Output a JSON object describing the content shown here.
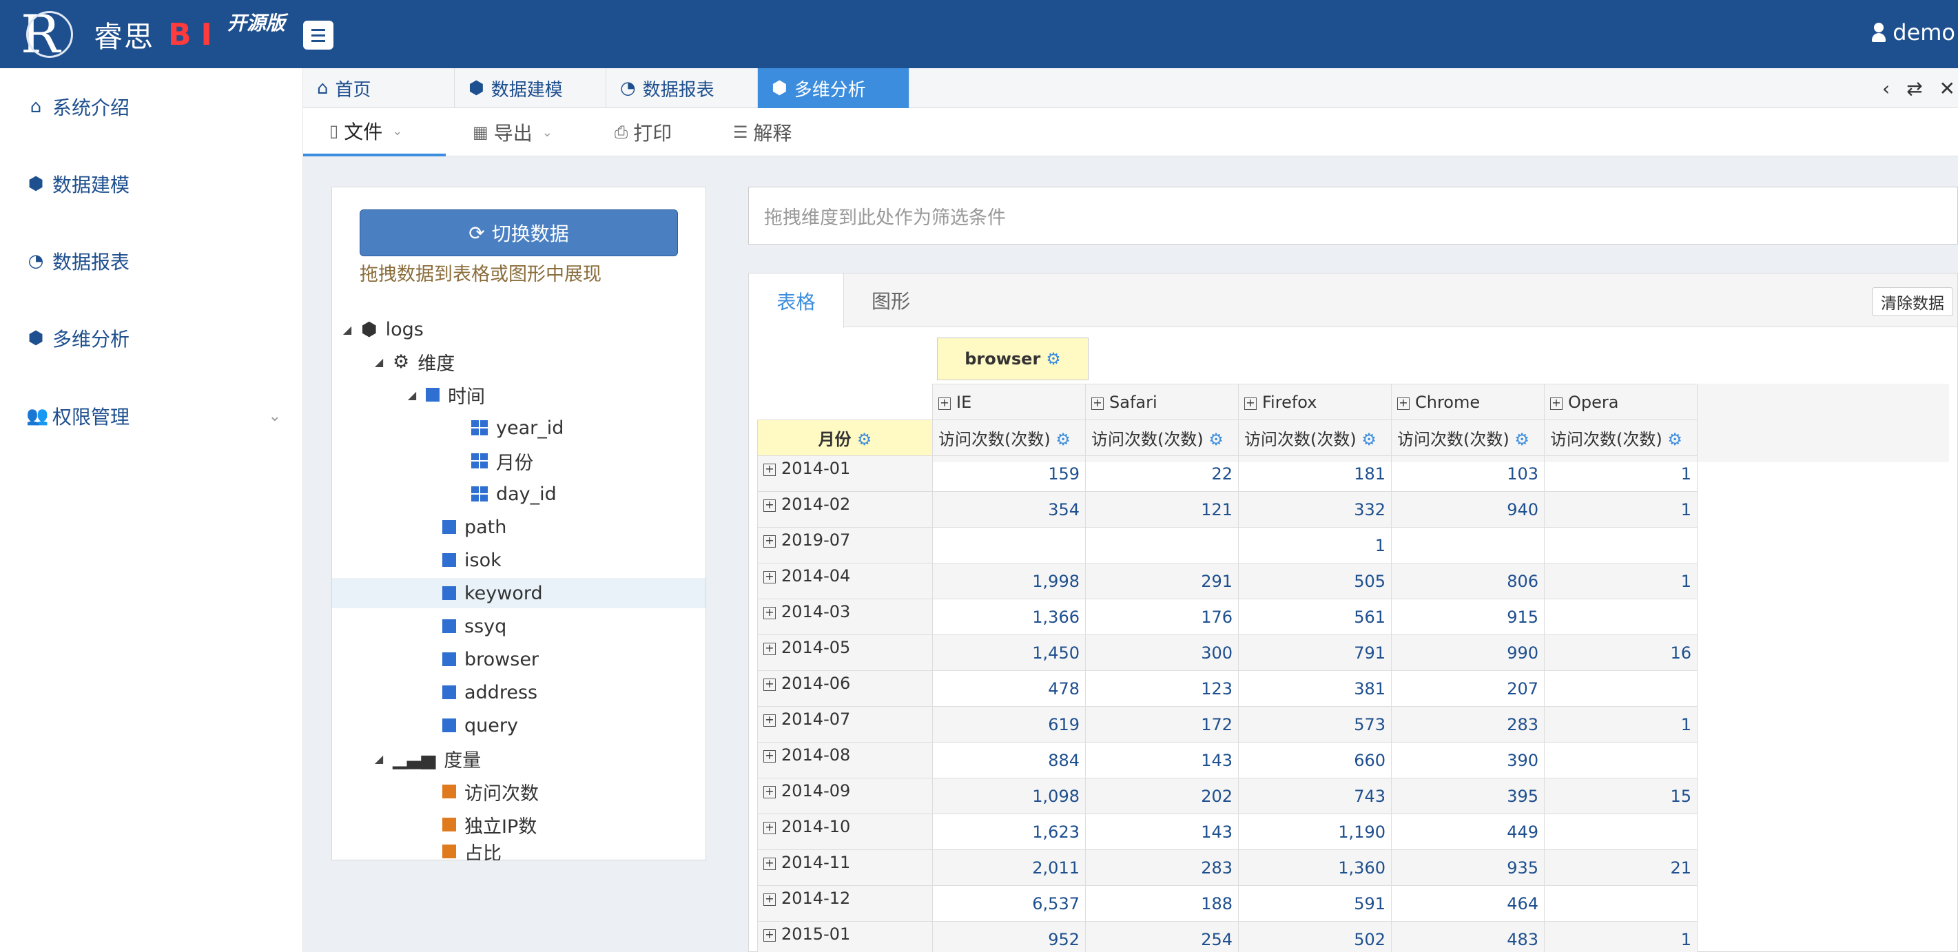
{
  "header": {
    "logo_letter": "R",
    "brand": "睿思",
    "bi": "BI",
    "edition": "开源版",
    "user": "demo"
  },
  "sidebar": {
    "items": [
      {
        "label": "系统介绍",
        "icon": "home-icon"
      },
      {
        "label": "数据建模",
        "icon": "cube-icon"
      },
      {
        "label": "数据报表",
        "icon": "dashboard-icon"
      },
      {
        "label": "多维分析",
        "icon": "cubes-icon"
      },
      {
        "label": "权限管理",
        "icon": "users-icon"
      }
    ]
  },
  "tabs": [
    {
      "label": "首页",
      "icon": "home-icon"
    },
    {
      "label": "数据建模",
      "icon": "cube-icon"
    },
    {
      "label": "数据报表",
      "icon": "dashboard-icon"
    },
    {
      "label": "多维分析",
      "icon": "cubes-icon",
      "active": true
    }
  ],
  "toolbar": {
    "file": "文件",
    "export": "导出",
    "print": "打印",
    "explain": "解释"
  },
  "datapanel": {
    "switch_label": "切换数据",
    "hint": "拖拽数据到表格或图形中展现",
    "tree": {
      "root": "logs",
      "dimension": "维度",
      "time": "时间",
      "time_children": [
        "year_id",
        "月份",
        "day_id"
      ],
      "dims": [
        "path",
        "isok",
        "keyword",
        "ssyq",
        "browser",
        "address",
        "query"
      ],
      "measure": "度量",
      "measures": [
        "访问次数",
        "独立IP数",
        "占比"
      ]
    }
  },
  "filter": {
    "placeholder": "拖拽维度到此处作为筛选条件"
  },
  "main": {
    "tab_table": "表格",
    "tab_chart": "图形",
    "clear": "清除数据",
    "col_dim": "browser",
    "row_dim": "月份",
    "measure_label": "访问次数(次数)",
    "browsers": [
      "IE",
      "Safari",
      "Firefox",
      "Chrome",
      "Opera"
    ],
    "rows": [
      {
        "month": "2014-01",
        "values": [
          "159",
          "22",
          "181",
          "103",
          "1"
        ]
      },
      {
        "month": "2014-02",
        "values": [
          "354",
          "121",
          "332",
          "940",
          "1"
        ]
      },
      {
        "month": "2019-07",
        "values": [
          "",
          "",
          "1",
          "",
          ""
        ]
      },
      {
        "month": "2014-04",
        "values": [
          "1,998",
          "291",
          "505",
          "806",
          "1"
        ]
      },
      {
        "month": "2014-03",
        "values": [
          "1,366",
          "176",
          "561",
          "915",
          ""
        ]
      },
      {
        "month": "2014-05",
        "values": [
          "1,450",
          "300",
          "791",
          "990",
          "16"
        ]
      },
      {
        "month": "2014-06",
        "values": [
          "478",
          "123",
          "381",
          "207",
          ""
        ]
      },
      {
        "month": "2014-07",
        "values": [
          "619",
          "172",
          "573",
          "283",
          "1"
        ]
      },
      {
        "month": "2014-08",
        "values": [
          "884",
          "143",
          "660",
          "390",
          ""
        ]
      },
      {
        "month": "2014-09",
        "values": [
          "1,098",
          "202",
          "743",
          "395",
          "15"
        ]
      },
      {
        "month": "2014-10",
        "values": [
          "1,623",
          "143",
          "1,190",
          "449",
          ""
        ]
      },
      {
        "month": "2014-11",
        "values": [
          "2,011",
          "283",
          "1,360",
          "935",
          "21"
        ]
      },
      {
        "month": "2014-12",
        "values": [
          "6,537",
          "188",
          "591",
          "464",
          ""
        ]
      },
      {
        "month": "2015-01",
        "values": [
          "952",
          "254",
          "502",
          "483",
          "1"
        ]
      }
    ]
  }
}
